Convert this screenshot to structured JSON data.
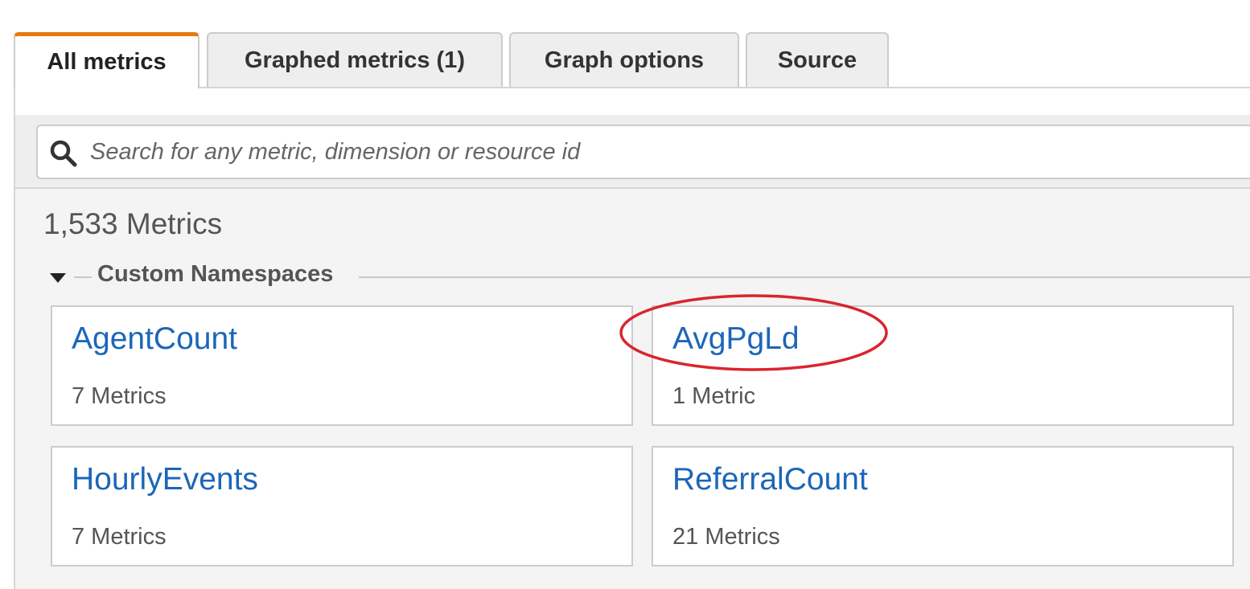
{
  "tabs": [
    {
      "label": "All metrics",
      "active": true
    },
    {
      "label": "Graphed metrics (1)",
      "active": false
    },
    {
      "label": "Graph options",
      "active": false
    },
    {
      "label": "Source",
      "active": false
    }
  ],
  "search": {
    "placeholder": "Search for any metric, dimension or resource id",
    "icon": "search-icon"
  },
  "summary": {
    "metrics_count": "1,533 Metrics"
  },
  "section": {
    "title": "Custom Namespaces",
    "expanded": true,
    "icon": "caret-down-icon"
  },
  "namespaces": [
    {
      "name": "AgentCount",
      "count": "7 Metrics"
    },
    {
      "name": "AvgPgLd",
      "count": "1 Metric"
    },
    {
      "name": "HourlyEvents",
      "count": "7 Metrics"
    },
    {
      "name": "ReferralCount",
      "count": "21 Metrics"
    }
  ],
  "colors": {
    "accent_tab": "#e47911",
    "link": "#1c66b8",
    "highlight": "#d9252f"
  }
}
